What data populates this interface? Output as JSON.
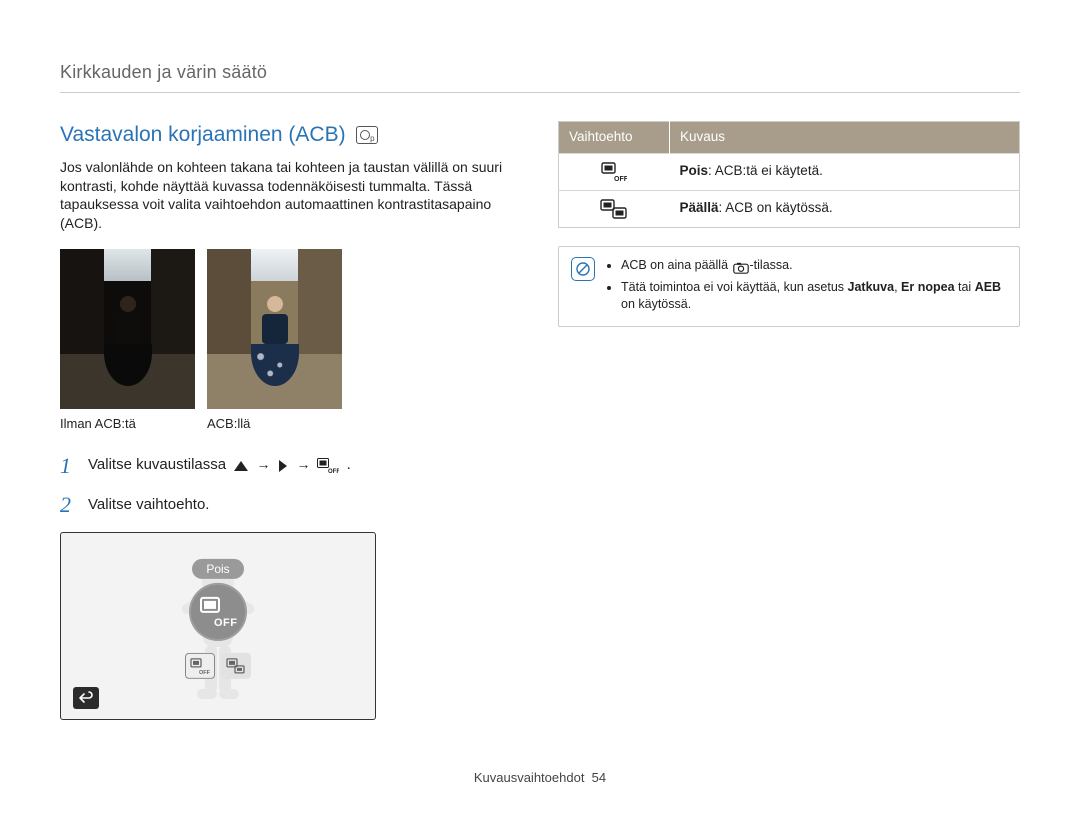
{
  "header": {
    "breadcrumb": "Kirkkauden ja värin säätö"
  },
  "section": {
    "title": "Vastavalon korjaaminen (ACB)",
    "body": "Jos valonlähde on kohteen takana tai kohteen ja taustan välillä on suuri kontrasti, kohde näyttää kuvassa todennäköisesti tummalta. Tässä tapauksessa voit valita vaihtoehdon automaattinen kontrastitasapaino (ACB)."
  },
  "photos": {
    "caption_left": "Ilman ACB:tä",
    "caption_right": "ACB:llä"
  },
  "steps": [
    {
      "n": "1",
      "text_prefix": "Valitse kuvaustilassa ",
      "text_suffix": "."
    },
    {
      "n": "2",
      "text": "Valitse vaihtoehto."
    }
  ],
  "lcd": {
    "center_label": "Pois"
  },
  "option_table": {
    "headers": [
      "Vaihtoehto",
      "Kuvaus"
    ],
    "rows": [
      {
        "bold": "Pois",
        "rest": ": ACB:tä ei käytetä."
      },
      {
        "bold": "Päällä",
        "rest": ": ACB on käytössä."
      }
    ]
  },
  "info": {
    "bullets": [
      {
        "pre": "ACB on aina päällä ",
        "post": "-tilassa."
      },
      {
        "pre": "Tätä toimintoa ei voi käyttää, kun asetus ",
        "b1": "Jatkuva",
        "mid1": ", ",
        "b2": "Er nopea",
        "mid2": " tai ",
        "b3": "AEB",
        "post": " on käytössä."
      }
    ]
  },
  "footer": {
    "chapter": "Kuvausvaihtoehdot",
    "page": "54"
  }
}
